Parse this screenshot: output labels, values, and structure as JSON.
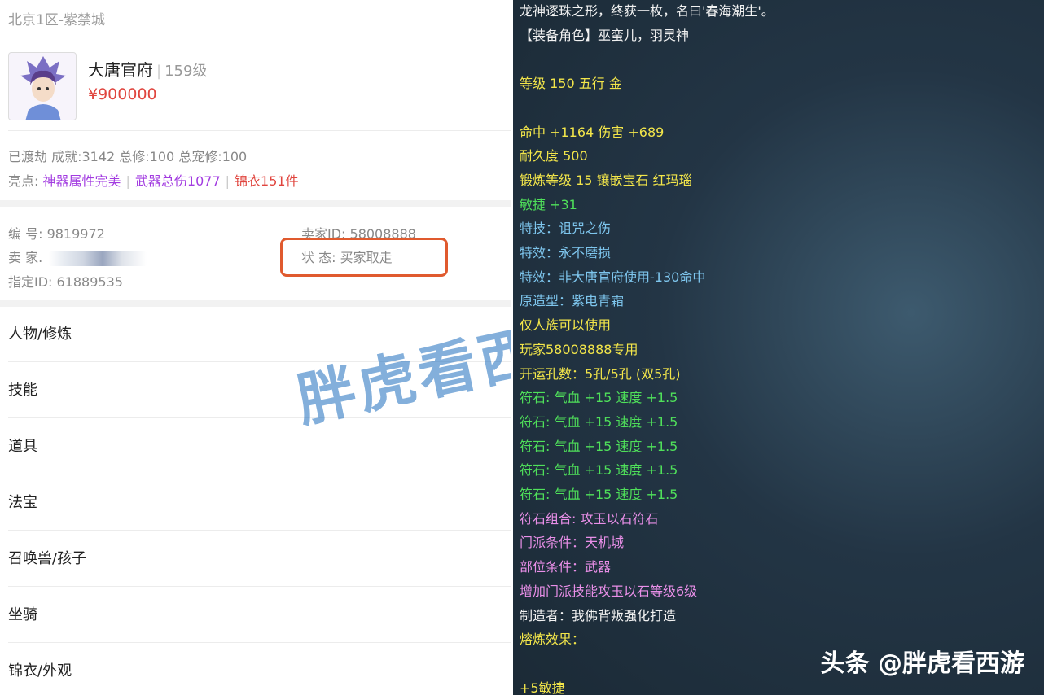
{
  "left": {
    "server": "北京1区-紫禁城",
    "role": {
      "name": "大唐官府",
      "level": "159级",
      "price": "¥900000"
    },
    "stats": "已渡劫 成就:3142 总修:100 总宠修:100",
    "highlights": {
      "label": "亮点:",
      "items": [
        {
          "text": "神器属性完美",
          "color": "#a23be0"
        },
        {
          "text": "武器总伤1077",
          "color": "#a23be0"
        },
        {
          "text": "锦衣151件",
          "color": "#e0453e"
        }
      ]
    },
    "info": {
      "id": "编 号: 9819972",
      "seller": "卖 家.",
      "appointed_id": "指定ID: 61889535",
      "seller_id": "卖家ID: 58008888",
      "status": "状 态: 买家取走"
    },
    "menu": [
      "人物/修炼",
      "技能",
      "道具",
      "法宝",
      "召唤兽/孩子",
      "坐骑",
      "锦衣/外观"
    ],
    "watermark": "胖虎看西游"
  },
  "right": {
    "lines": [
      {
        "text": "龙神逐珠之形，终获一枚，名曰'春海潮生'。",
        "color": "white"
      },
      {
        "text": "【装备角色】巫蛮儿，羽灵神",
        "color": "white"
      },
      {
        "text": "",
        "color": "white"
      },
      {
        "text": "等级 150 五行 金",
        "color": "yellow"
      },
      {
        "text": "",
        "color": "white"
      },
      {
        "text": "命中 +1164 伤害 +689",
        "color": "yellow"
      },
      {
        "text": "耐久度 500",
        "color": "yellow"
      },
      {
        "text": "锻炼等级 15 镶嵌宝石 红玛瑙",
        "color": "yellow"
      },
      {
        "text": "敏捷 +31",
        "color": "green"
      },
      {
        "text": "特技：诅咒之伤",
        "color": "blue"
      },
      {
        "text": "特效：永不磨损",
        "color": "blue"
      },
      {
        "text": "特效：非大唐官府使用-130命中",
        "color": "blue"
      },
      {
        "text": "原造型：紫电青霜",
        "color": "blue"
      },
      {
        "text": "仅人族可以使用",
        "color": "yellow"
      },
      {
        "text": "玩家58008888专用",
        "color": "yellow"
      },
      {
        "text": "开运孔数：5孔/5孔 (双5孔)",
        "color": "yellow"
      },
      {
        "text": "符石: 气血 +15 速度 +1.5",
        "color": "green"
      },
      {
        "text": "符石: 气血 +15 速度 +1.5",
        "color": "green"
      },
      {
        "text": "符石: 气血 +15 速度 +1.5",
        "color": "green"
      },
      {
        "text": "符石: 气血 +15 速度 +1.5",
        "color": "green"
      },
      {
        "text": "符石: 气血 +15 速度 +1.5",
        "color": "green"
      },
      {
        "text": "符石组合: 攻玉以石符石",
        "color": "pink"
      },
      {
        "text": "门派条件：天机城",
        "color": "pink"
      },
      {
        "text": "部位条件：武器",
        "color": "pink"
      },
      {
        "text": "增加门派技能攻玉以石等级6级",
        "color": "pink"
      },
      {
        "text": "制造者：我佛背叛强化打造",
        "color": "white"
      },
      {
        "text": "熔炼效果：",
        "color": "yellow"
      },
      {
        "text": "",
        "color": "white"
      },
      {
        "text": "+5敏捷",
        "color": "yellow"
      }
    ],
    "footer": "头条 @胖虎看西游"
  }
}
